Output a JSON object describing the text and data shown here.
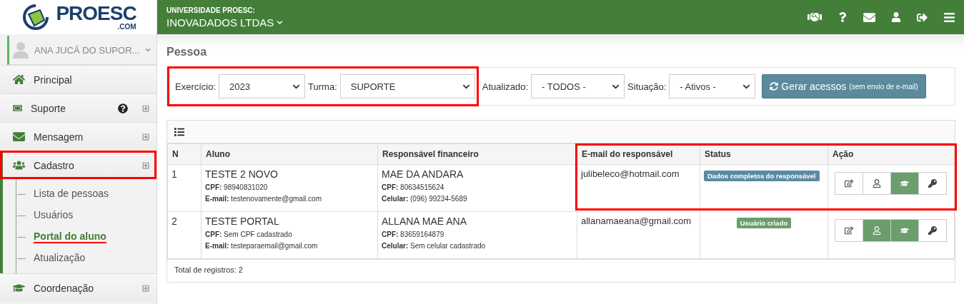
{
  "header": {
    "institution": "UNIVERSIDADE PROESC:",
    "company": "INOVADADOS LTDAS"
  },
  "logo": {
    "name": "PROESC",
    "domain": ".COM"
  },
  "sidebar": {
    "user": "ANA JUCÁ DO SUPOR...",
    "items": [
      {
        "kind": "home",
        "label": "Principal",
        "expandable": false,
        "help": false,
        "expanded": false,
        "highlighted": false
      },
      {
        "kind": "ticket",
        "label": "Suporte",
        "expandable": true,
        "help": true,
        "expanded": false,
        "highlighted": false
      },
      {
        "kind": "mail",
        "label": "Mensagem",
        "expandable": true,
        "help": false,
        "expanded": false,
        "highlighted": false
      },
      {
        "kind": "users",
        "label": "Cadastro",
        "expandable": true,
        "help": false,
        "expanded": true,
        "highlighted": true,
        "children": [
          {
            "label": "Lista de pessoas",
            "selected": false
          },
          {
            "label": "Usuários",
            "selected": false
          },
          {
            "label": "Portal do aluno",
            "selected": true
          },
          {
            "label": "Atualização",
            "selected": false
          }
        ]
      },
      {
        "kind": "cap",
        "label": "Coordenação",
        "expandable": true,
        "help": false,
        "expanded": false,
        "highlighted": false
      }
    ]
  },
  "page_title": "Pessoa",
  "filters": [
    {
      "label": "Exercício:",
      "value": "2023",
      "highlighted": true
    },
    {
      "label": "Turma:",
      "value": "SUPORTE",
      "highlighted": true
    },
    {
      "label": "Atualizado:",
      "value": "- TODOS -",
      "highlighted": false
    },
    {
      "label": "Situação:",
      "value": "- Ativos -",
      "highlighted": false
    }
  ],
  "generate_button": {
    "label": "Gerar acessos",
    "note": "(sem envio de e-mail)"
  },
  "table": {
    "columns": [
      {
        "label": "N",
        "highlighted": false
      },
      {
        "label": "Aluno",
        "highlighted": false
      },
      {
        "label": "Responsável financeiro",
        "highlighted": false
      },
      {
        "label": "E-mail do responsável",
        "highlighted": true
      },
      {
        "label": "Status",
        "highlighted": true
      },
      {
        "label": "Ação",
        "highlighted": true
      }
    ],
    "rows": [
      {
        "n": "1",
        "highlighted": true,
        "student": "TESTE 2 NOVO",
        "student_cpf": "**CPF:** 98940831020",
        "student_email": "**E-mail:** testenovamente@gmail.com",
        "guardian": "MAE DA ANDARA",
        "guardian_cpf": "**CPF:** 80634515624",
        "guardian_phone": "**Celular:** (096) 99234-5689",
        "email": "julibeleco@hotmail.com",
        "status": "Dados completos do responsável",
        "color": "#5b8ba1",
        "actions": [
          {
            "kind": "edit",
            "active": false
          },
          {
            "kind": "user",
            "active": false
          },
          {
            "kind": "cap",
            "active": true
          },
          {
            "kind": "key",
            "active": false
          }
        ]
      },
      {
        "n": "2",
        "highlighted": false,
        "student": "TESTE PORTAL",
        "student_cpf": "**CPF:** Sem CPF cadastrado",
        "student_email": "**E-mail:** testeparaemail@gmail.com",
        "guardian": "ALLANA MAE ANA",
        "guardian_cpf": "**CPF:** 83659164879",
        "guardian_phone": "**Celular:** Sem celular cadastrado",
        "email": "allanamaeana@gmail.com",
        "status": "Usuário criado",
        "color": "#6a9e6a",
        "actions": [
          {
            "kind": "edit",
            "active": false
          },
          {
            "kind": "user",
            "active": true
          },
          {
            "kind": "cap",
            "active": true
          },
          {
            "kind": "key",
            "active": false
          }
        ]
      }
    ],
    "footer": "Total de registros: 2"
  }
}
